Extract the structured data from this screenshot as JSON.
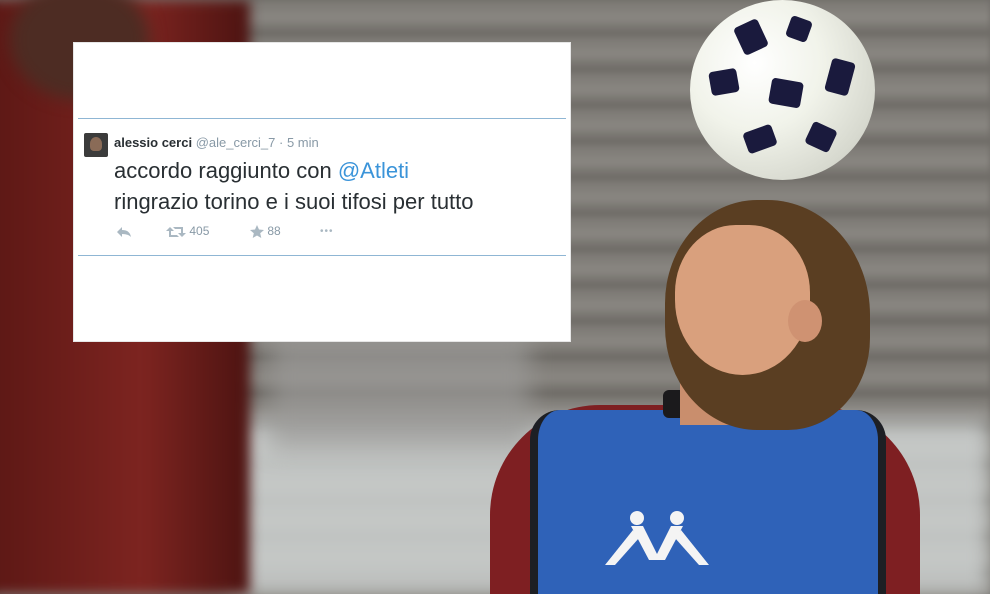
{
  "tweet": {
    "user_name": "alessio cerci",
    "handle": "@ale_cerci_7",
    "separator": "·",
    "time": "5 min",
    "text_part1": "accordo raggiunto con ",
    "mention": "@Atleti",
    "text_line2": "ringrazio torino e i suoi tifosi per tutto",
    "retweet_count": "405",
    "favorite_count": "88",
    "more_label": "•••"
  },
  "colors": {
    "mention": "#3b94d9",
    "text": "#292f33",
    "meta": "#8899a6",
    "divider": "#8fb6d4",
    "shirt": "#7e1f22",
    "bib": "#2f62b8"
  },
  "icons": [
    "reply-icon",
    "retweet-icon",
    "star-icon",
    "more-icon"
  ]
}
